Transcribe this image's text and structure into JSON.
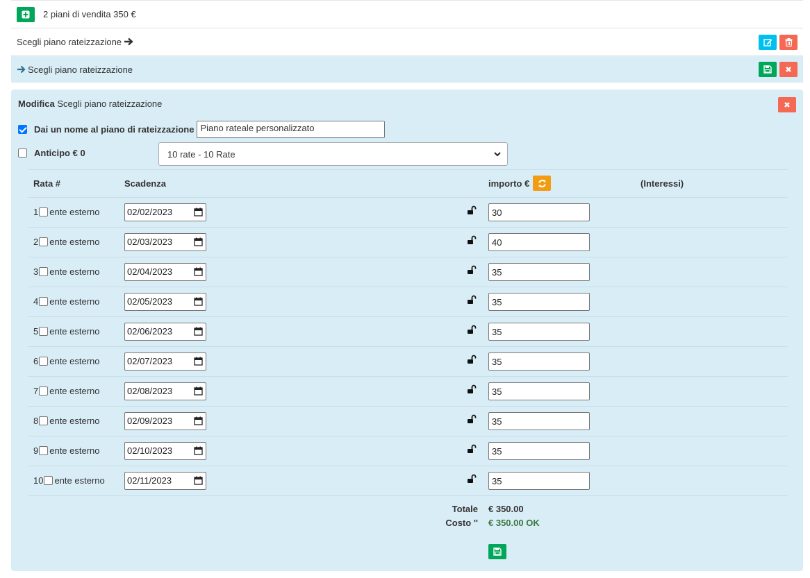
{
  "top": {
    "text": "2 piani di vendita 350 €"
  },
  "plan_row": {
    "label": "Scegli piano rateizzazione"
  },
  "plan_row2": {
    "label": "Scegli piano rateizzazione"
  },
  "edit": {
    "title_bold": "Modifica",
    "title_rest": " Scegli piano rateizzazione",
    "name_label": "Dai un nome al piano di rateizzazione",
    "name_value": "Piano rateale personalizzato",
    "anticipo_label": "Anticipo € 0",
    "select_value": "10 rate - 10 Rate"
  },
  "table": {
    "headers": {
      "rata": "Rata #",
      "scadenza": "Scadenza",
      "importo": "importo €",
      "interessi": "(Interessi)"
    },
    "external_label": "ente esterno",
    "rows": [
      {
        "n": "1",
        "date": "02/02/2023",
        "amount": "30"
      },
      {
        "n": "2",
        "date": "02/03/2023",
        "amount": "40"
      },
      {
        "n": "3",
        "date": "02/04/2023",
        "amount": "35"
      },
      {
        "n": "4",
        "date": "02/05/2023",
        "amount": "35"
      },
      {
        "n": "5",
        "date": "02/06/2023",
        "amount": "35"
      },
      {
        "n": "6",
        "date": "02/07/2023",
        "amount": "35"
      },
      {
        "n": "7",
        "date": "02/08/2023",
        "amount": "35"
      },
      {
        "n": "8",
        "date": "02/09/2023",
        "amount": "35"
      },
      {
        "n": "9",
        "date": "02/10/2023",
        "amount": "35"
      },
      {
        "n": "10",
        "date": "02/11/2023",
        "amount": "35"
      }
    ]
  },
  "totals": {
    "totale_label": "Totale",
    "totale_value": "€ 350.00",
    "costo_label": "Costo ''",
    "costo_value": "€ 350.00 OK"
  },
  "colors": {
    "panel": "#d9edf7",
    "green": "#00a65a",
    "cyan": "#00c0ef",
    "red": "#dd4b39",
    "orange": "#f39c12"
  }
}
